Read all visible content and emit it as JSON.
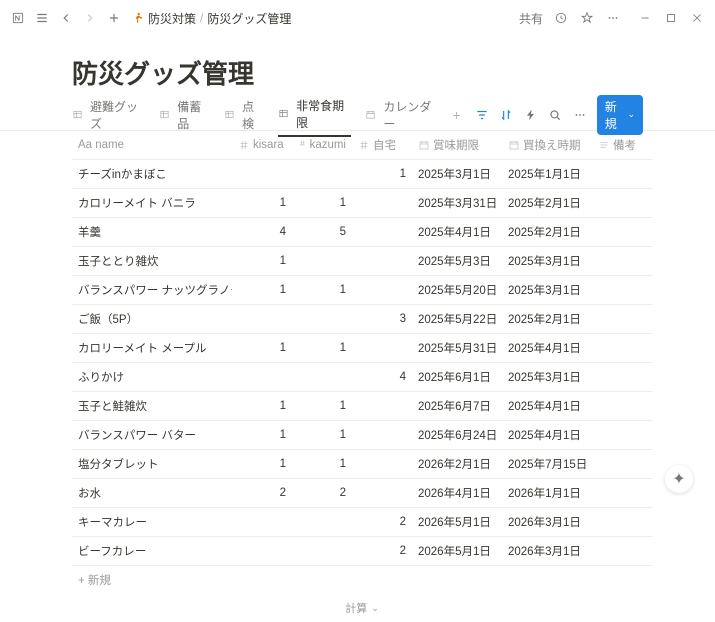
{
  "topbar": {
    "breadcrumb_icon": "running",
    "breadcrumb1": "防災対策",
    "breadcrumb2": "防災グッズ管理",
    "share": "共有"
  },
  "page": {
    "title": "防災グッズ管理"
  },
  "tabs": [
    {
      "icon": "table",
      "label": "避難グッズ"
    },
    {
      "icon": "table",
      "label": "備蓄品"
    },
    {
      "icon": "table",
      "label": "点検"
    },
    {
      "icon": "table",
      "label": "非常食期限",
      "active": true
    },
    {
      "icon": "calendar",
      "label": "カレンダー"
    }
  ],
  "actions": {
    "new_label": "新規"
  },
  "columns": [
    {
      "key": "name",
      "label": "Aa name",
      "icon": "text"
    },
    {
      "key": "kisara",
      "label": "kisara",
      "icon": "hash"
    },
    {
      "key": "kazumi",
      "label": "kazumi",
      "icon": "hash"
    },
    {
      "key": "home",
      "label": "自宅",
      "icon": "hash"
    },
    {
      "key": "expiry",
      "label": "賞味期限",
      "icon": "calendar"
    },
    {
      "key": "replace",
      "label": "買換え時期",
      "icon": "calendar"
    },
    {
      "key": "note",
      "label": "備考",
      "icon": "lines"
    }
  ],
  "rows": [
    {
      "name": "チーズinかまぼこ",
      "kisara": "",
      "kazumi": "",
      "home": "1",
      "expiry": "2025年3月1日",
      "replace": "2025年1月1日"
    },
    {
      "name": "カロリーメイト バニラ",
      "kisara": "1",
      "kazumi": "1",
      "home": "",
      "expiry": "2025年3月31日",
      "replace": "2025年2月1日"
    },
    {
      "name": "羊羹",
      "kisara": "4",
      "kazumi": "5",
      "home": "",
      "expiry": "2025年4月1日",
      "replace": "2025年2月1日"
    },
    {
      "name": "玉子ととり雑炊",
      "kisara": "1",
      "kazumi": "",
      "home": "",
      "expiry": "2025年5月3日",
      "replace": "2025年3月1日"
    },
    {
      "name": "バランスパワー ナッツグラノーラ",
      "kisara": "1",
      "kazumi": "1",
      "home": "",
      "expiry": "2025年5月20日",
      "replace": "2025年3月1日"
    },
    {
      "name": "ご飯（5P）",
      "kisara": "",
      "kazumi": "",
      "home": "3",
      "expiry": "2025年5月22日",
      "replace": "2025年2月1日"
    },
    {
      "name": "カロリーメイト メープル",
      "kisara": "1",
      "kazumi": "1",
      "home": "",
      "expiry": "2025年5月31日",
      "replace": "2025年4月1日"
    },
    {
      "name": "ふりかけ",
      "kisara": "",
      "kazumi": "",
      "home": "4",
      "expiry": "2025年6月1日",
      "replace": "2025年3月1日"
    },
    {
      "name": "玉子と鮭雑炊",
      "kisara": "1",
      "kazumi": "1",
      "home": "",
      "expiry": "2025年6月7日",
      "replace": "2025年4月1日"
    },
    {
      "name": "バランスパワー バター",
      "kisara": "1",
      "kazumi": "1",
      "home": "",
      "expiry": "2025年6月24日",
      "replace": "2025年4月1日"
    },
    {
      "name": "塩分タブレット",
      "kisara": "1",
      "kazumi": "1",
      "home": "",
      "expiry": "2026年2月1日",
      "replace": "2025年7月15日"
    },
    {
      "name": "お水",
      "kisara": "2",
      "kazumi": "2",
      "home": "",
      "expiry": "2026年4月1日",
      "replace": "2026年1月1日"
    },
    {
      "name": "キーマカレー",
      "kisara": "",
      "kazumi": "",
      "home": "2",
      "expiry": "2026年5月1日",
      "replace": "2026年3月1日"
    },
    {
      "name": "ビーフカレー",
      "kisara": "",
      "kazumi": "",
      "home": "2",
      "expiry": "2026年5月1日",
      "replace": "2026年3月1日"
    }
  ],
  "footer": {
    "add_row": "+ 新規",
    "calc": "計算"
  }
}
